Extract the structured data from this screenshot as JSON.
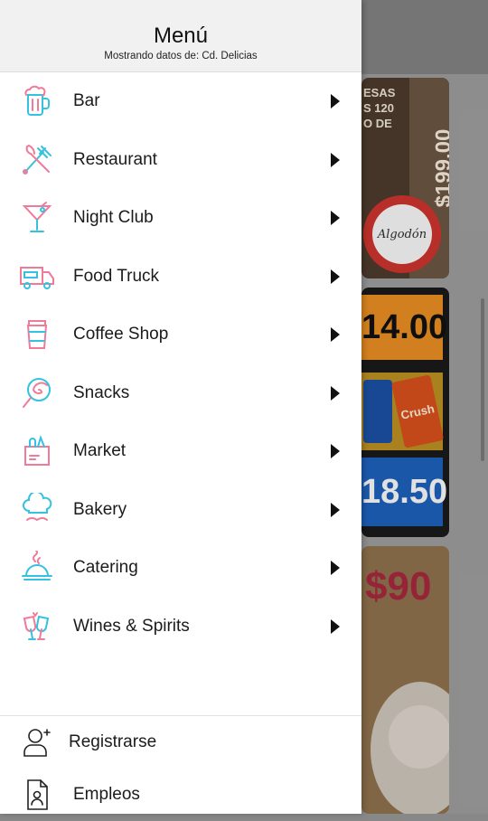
{
  "header": {
    "title": "Menú",
    "subtitle": "Mostrando datos de: Cd. Delicias"
  },
  "menu": {
    "items": [
      {
        "label": "Bar",
        "icon": "beer-mug-icon"
      },
      {
        "label": "Restaurant",
        "icon": "fork-knife-icon"
      },
      {
        "label": "Night Club",
        "icon": "cocktail-glass-icon"
      },
      {
        "label": "Food Truck",
        "icon": "food-truck-icon"
      },
      {
        "label": "Coffee Shop",
        "icon": "coffee-cup-icon"
      },
      {
        "label": "Snacks",
        "icon": "lollipop-icon"
      },
      {
        "label": "Market",
        "icon": "grocery-bag-icon"
      },
      {
        "label": "Bakery",
        "icon": "chef-hat-icon"
      },
      {
        "label": "Catering",
        "icon": "serving-cloche-icon"
      },
      {
        "label": "Wines & Spirits",
        "icon": "wine-glasses-icon"
      }
    ]
  },
  "footer": {
    "register_label": "Registrarse",
    "jobs_label": "Empleos"
  },
  "background": {
    "card1_text": "ESAS\nS 120\nO DE",
    "card1_price": "$199.00",
    "card1_logo": "Algodón",
    "card2_price_top": "14.00",
    "card2_can": "Crush",
    "card2_price_bottom": "18.50",
    "card3_price": "$90"
  },
  "colors": {
    "icon_pink": "#f07a9a",
    "icon_cyan": "#35c2e0",
    "chevron": "#111111"
  }
}
